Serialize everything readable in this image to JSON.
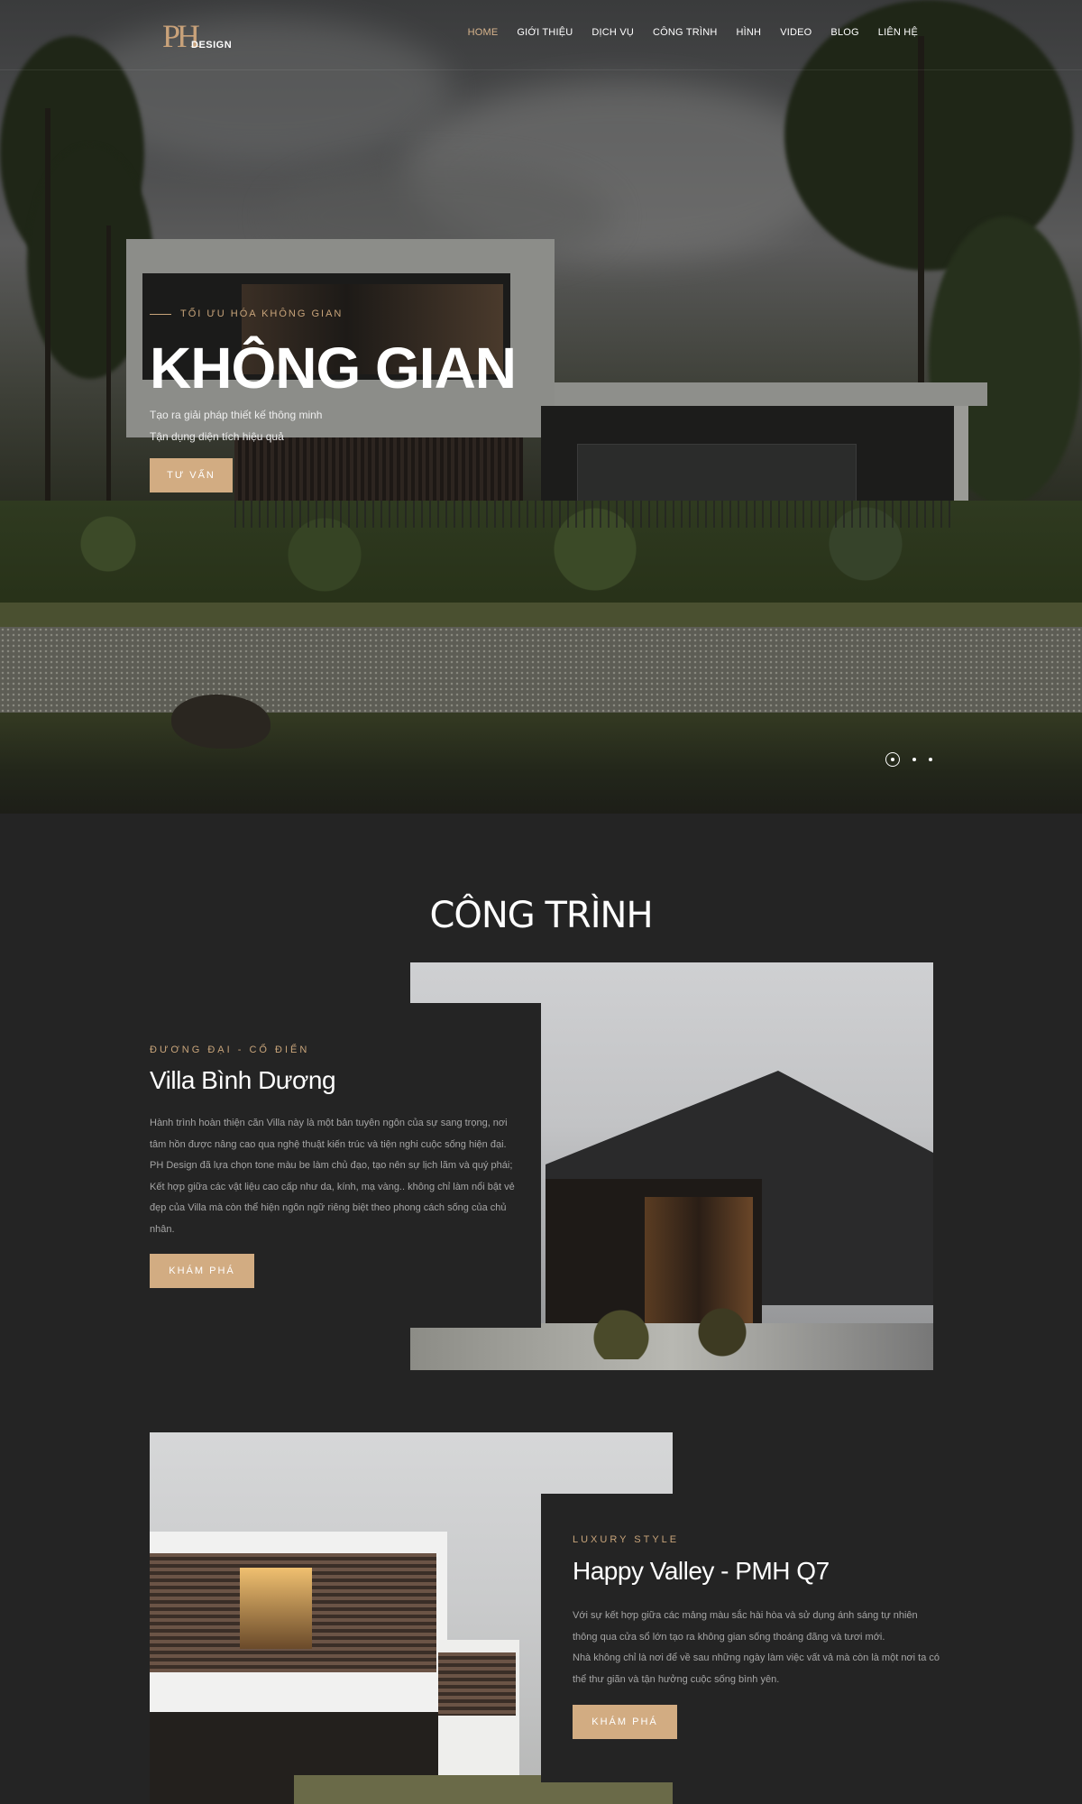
{
  "brand": {
    "logo_mark": "PH",
    "logo_text": "DESIGN"
  },
  "nav": [
    {
      "label": "HOME",
      "active": true
    },
    {
      "label": "GIỚI THIỆU",
      "active": false
    },
    {
      "label": "DỊCH VỤ",
      "active": false
    },
    {
      "label": "CÔNG TRÌNH",
      "active": false
    },
    {
      "label": "HÌNH",
      "active": false
    },
    {
      "label": "VIDEO",
      "active": false
    },
    {
      "label": "BLOG",
      "active": false
    },
    {
      "label": "LIÊN HỆ",
      "active": false
    }
  ],
  "hero": {
    "eyebrow": "TỐI ƯU HÓA KHÔNG GIAN",
    "title": "KHÔNG GIAN",
    "line1": "Tạo ra giải pháp thiết kế thông minh",
    "line2": "Tận dụng diện tích hiệu quả",
    "button": "TƯ VẤN",
    "slides": 3,
    "active_slide": 1
  },
  "section": {
    "title": "CÔNG TRÌNH"
  },
  "projects": [
    {
      "eyebrow": "ĐƯƠNG ĐẠI - CỔ ĐIỂN",
      "name": "Villa Bình Dương",
      "desc_lines": [
        "Hành trình hoàn thiện căn Villa này là một bản tuyên ngôn của sự sang trọng, nơi",
        "tâm hồn được nâng cao qua nghệ thuật kiến trúc và tiện nghi cuộc sống hiện đại.",
        "PH Design đã lựa chọn tone màu be làm chủ đạo, tạo nên sự lịch lãm và quý phái;",
        "Kết hợp giữa các vật liệu cao cấp như da, kính, mạ vàng.. không chỉ làm nổi bật vẻ",
        "đẹp của Villa mà còn thể hiện ngôn ngữ riêng biệt theo phong cách sống của chủ",
        "nhân."
      ],
      "button": "KHÁM PHÁ"
    },
    {
      "eyebrow": "LUXURY STYLE",
      "name": "Happy Valley - PMH Q7",
      "desc_lines": [
        "Với sự kết hợp giữa các mảng màu sắc hài hòa và sử dụng ánh sáng tự nhiên",
        "thông qua cửa sổ lớn tạo ra không gian sống thoáng đãng và tươi mới.",
        "Nhà không chỉ là nơi để về sau những ngày làm việc vất vả mà còn là một nơi ta có",
        "thể thư giãn và tận hưởng cuộc sống bình yên."
      ],
      "button": "KHÁM PHÁ"
    }
  ],
  "colors": {
    "accent": "#d2ac82",
    "background": "#242424"
  }
}
